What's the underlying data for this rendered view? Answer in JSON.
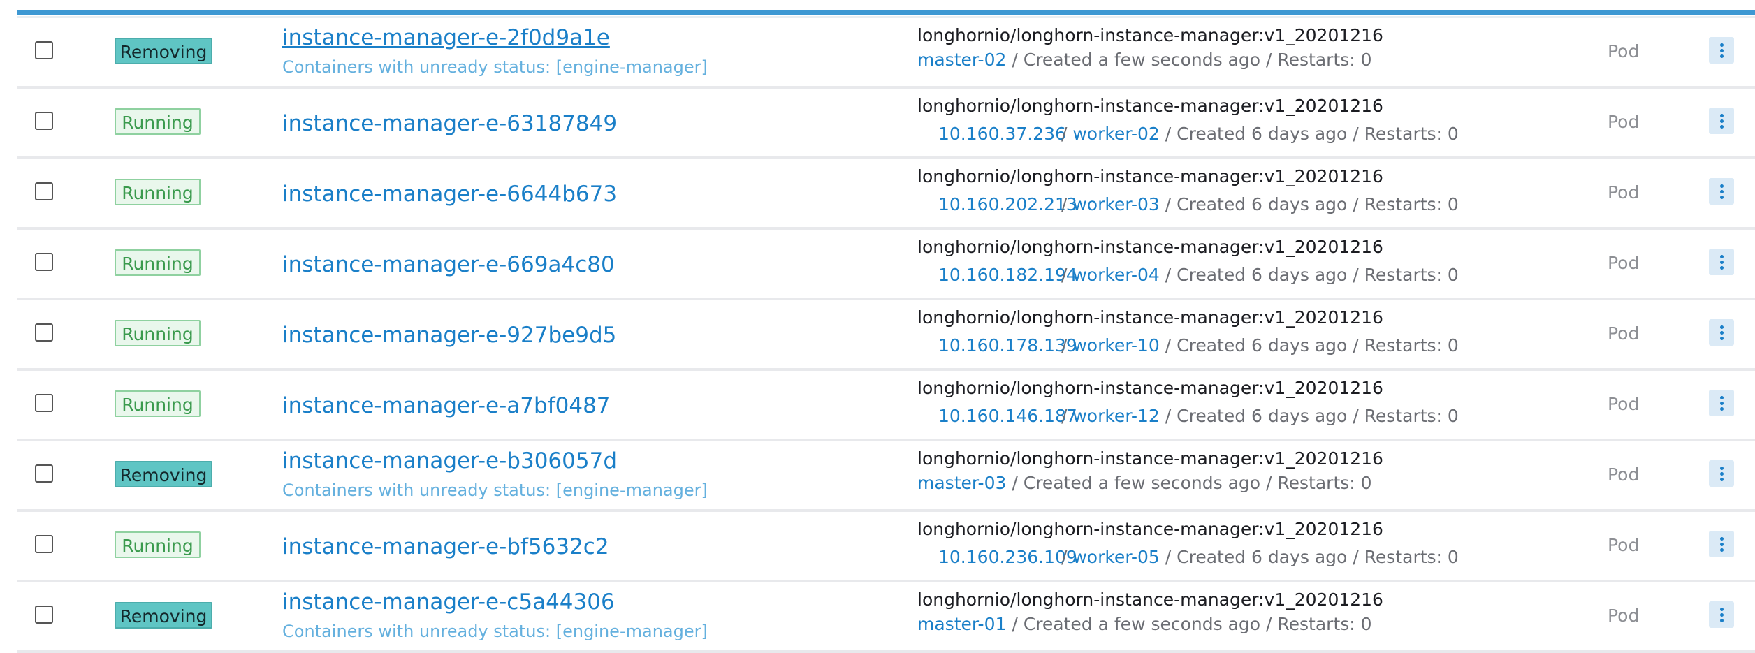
{
  "rows": [
    {
      "status": "Removing",
      "name": "instance-manager-e-2f0d9a1e",
      "sub": "Containers with unready status: [engine-manager]",
      "image": "longhornio/longhorn-instance-manager:v1_20201216",
      "ip": "",
      "node": "master-02",
      "created": "Created a few seconds ago",
      "restarts": "Restarts: 0",
      "kind": "Pod"
    },
    {
      "status": "Running",
      "name": "instance-manager-e-63187849",
      "sub": "",
      "image": "longhornio/longhorn-instance-manager:v1_20201216",
      "ip": "10.160.37.236",
      "node": "worker-02",
      "created": "Created 6 days ago",
      "restarts": "Restarts: 0",
      "kind": "Pod"
    },
    {
      "status": "Running",
      "name": "instance-manager-e-6644b673",
      "sub": "",
      "image": "longhornio/longhorn-instance-manager:v1_20201216",
      "ip": "10.160.202.213",
      "node": "worker-03",
      "created": "Created 6 days ago",
      "restarts": "Restarts: 0",
      "kind": "Pod"
    },
    {
      "status": "Running",
      "name": "instance-manager-e-669a4c80",
      "sub": "",
      "image": "longhornio/longhorn-instance-manager:v1_20201216",
      "ip": "10.160.182.194",
      "node": "worker-04",
      "created": "Created 6 days ago",
      "restarts": "Restarts: 0",
      "kind": "Pod"
    },
    {
      "status": "Running",
      "name": "instance-manager-e-927be9d5",
      "sub": "",
      "image": "longhornio/longhorn-instance-manager:v1_20201216",
      "ip": "10.160.178.139",
      "node": "worker-10",
      "created": "Created 6 days ago",
      "restarts": "Restarts: 0",
      "kind": "Pod"
    },
    {
      "status": "Running",
      "name": "instance-manager-e-a7bf0487",
      "sub": "",
      "image": "longhornio/longhorn-instance-manager:v1_20201216",
      "ip": "10.160.146.187",
      "node": "worker-12",
      "created": "Created 6 days ago",
      "restarts": "Restarts: 0",
      "kind": "Pod"
    },
    {
      "status": "Removing",
      "name": "instance-manager-e-b306057d",
      "sub": "Containers with unready status: [engine-manager]",
      "image": "longhornio/longhorn-instance-manager:v1_20201216",
      "ip": "",
      "node": "master-03",
      "created": "Created a few seconds ago",
      "restarts": "Restarts: 0",
      "kind": "Pod"
    },
    {
      "status": "Running",
      "name": "instance-manager-e-bf5632c2",
      "sub": "",
      "image": "longhornio/longhorn-instance-manager:v1_20201216",
      "ip": "10.160.236.109",
      "node": "worker-05",
      "created": "Created 6 days ago",
      "restarts": "Restarts: 0",
      "kind": "Pod"
    },
    {
      "status": "Removing",
      "name": "instance-manager-e-c5a44306",
      "sub": "Containers with unready status: [engine-manager]",
      "image": "longhornio/longhorn-instance-manager:v1_20201216",
      "ip": "",
      "node": "master-01",
      "created": "Created a few seconds ago",
      "restarts": "Restarts: 0",
      "kind": "Pod"
    }
  ],
  "separator": " / ",
  "icons": {
    "row_actions": "vertical-dots-icon",
    "select": "checkbox"
  },
  "colors": {
    "accent": "#3d98d3",
    "link": "#1a7fc8",
    "running": "#3a9a4d",
    "removing": "#5fc5c4"
  }
}
